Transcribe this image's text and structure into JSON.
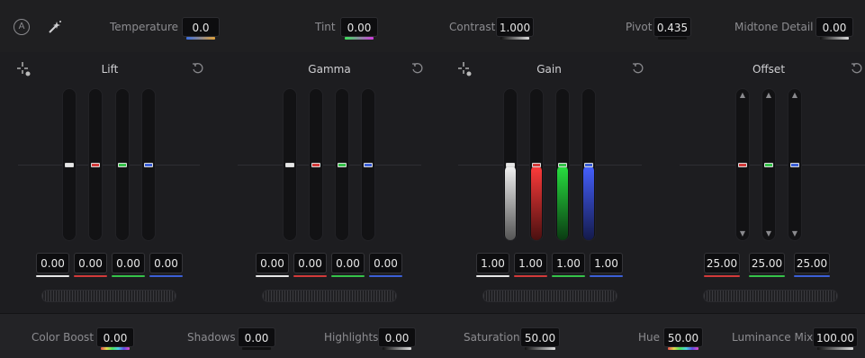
{
  "top": {
    "auto_label": "A",
    "temperature": {
      "label": "Temperature",
      "value": "0.0"
    },
    "tint": {
      "label": "Tint",
      "value": "0.00"
    },
    "contrast": {
      "label": "Contrast",
      "value": "1.000"
    },
    "pivot": {
      "label": "Pivot",
      "value": "0.435"
    },
    "midtone_detail": {
      "label": "Midtone Detail",
      "value": "0.00"
    }
  },
  "panels": [
    {
      "title": "Lift",
      "values": [
        "0.00",
        "0.00",
        "0.00",
        "0.00"
      ],
      "level": 0.5
    },
    {
      "title": "Gamma",
      "values": [
        "0.00",
        "0.00",
        "0.00",
        "0.00"
      ],
      "level": 0.5
    },
    {
      "title": "Gain",
      "values": [
        "1.00",
        "1.00",
        "1.00",
        "1.00"
      ],
      "level": 0.5
    },
    {
      "title": "Offset",
      "values": [
        "25.00",
        "25.00",
        "25.00"
      ],
      "level": 0.5
    }
  ],
  "bottom": {
    "color_boost": {
      "label": "Color Boost",
      "value": "0.00"
    },
    "shadows": {
      "label": "Shadows",
      "value": "0.00"
    },
    "highlights": {
      "label": "Highlights",
      "value": "0.00"
    },
    "saturation": {
      "label": "Saturation",
      "value": "50.00"
    },
    "hue": {
      "label": "Hue",
      "value": "50.00"
    },
    "luminance_mix": {
      "label": "Luminance Mix",
      "value": "100.00"
    }
  },
  "colors": {
    "master": "#e6e6e6",
    "red": "#d23a3a",
    "green": "#35c24a",
    "blue": "#3b5fd6"
  },
  "icons": [
    "auto-balance-icon",
    "picker-wand-icon",
    "reset-icon",
    "crosshair-picker-icon",
    "chevron-up-icon",
    "chevron-down-icon"
  ]
}
